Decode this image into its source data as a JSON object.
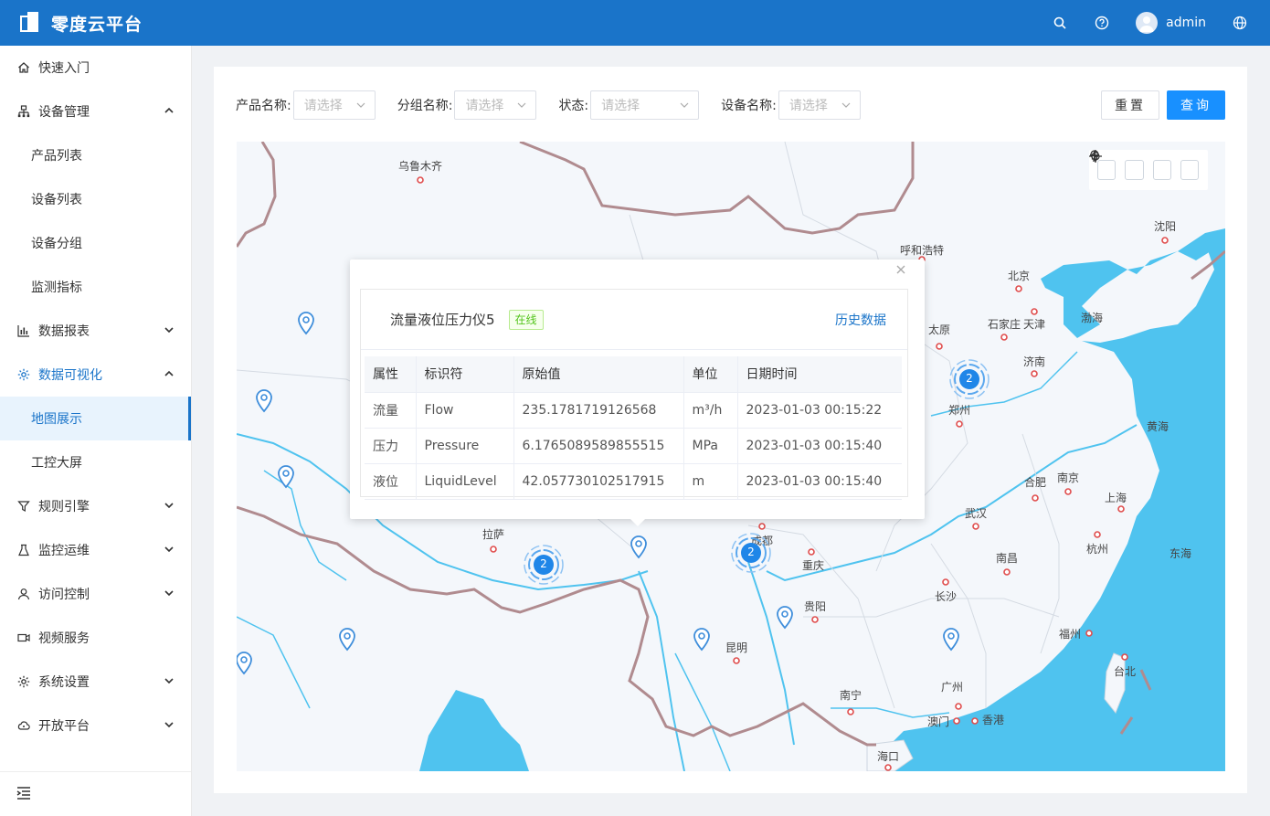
{
  "app": {
    "title": "零度云平台"
  },
  "header": {
    "username": "admin",
    "icons": [
      "search-icon",
      "help-icon",
      "avatar",
      "globe-icon"
    ]
  },
  "sidebar": {
    "items": [
      {
        "label": "快速入门",
        "icon": "home-icon"
      },
      {
        "label": "设备管理",
        "icon": "device-icon",
        "expanded": true,
        "children": [
          "产品列表",
          "设备列表",
          "设备分组",
          "监测指标"
        ]
      },
      {
        "label": "数据报表",
        "icon": "bar-chart-icon",
        "expanded": false
      },
      {
        "label": "数据可视化",
        "icon": "gear-icon",
        "expanded": true,
        "active": true,
        "children": [
          "地图展示",
          "工控大屏"
        ],
        "active_child": "地图展示"
      },
      {
        "label": "规则引擎",
        "icon": "filter-icon",
        "expanded": false
      },
      {
        "label": "监控运维",
        "icon": "flask-icon",
        "expanded": false
      },
      {
        "label": "访问控制",
        "icon": "user-icon",
        "expanded": false
      },
      {
        "label": "视频服务",
        "icon": "video-icon"
      },
      {
        "label": "系统设置",
        "icon": "settings-icon",
        "expanded": false
      },
      {
        "label": "开放平台",
        "icon": "cloud-icon",
        "expanded": false
      }
    ]
  },
  "filters": {
    "product_label": "产品名称:",
    "group_label": "分组名称:",
    "status_label": "状态:",
    "device_label": "设备名称:",
    "placeholder": "请选择",
    "reset": "重置",
    "query": "查询"
  },
  "map": {
    "cities": {
      "wulumuqi": "乌鲁木齐",
      "huhehaote": "呼和浩特",
      "shenyang": "沈阳",
      "beijing": "北京",
      "tianjin": "天津",
      "shijiazhuang": "石家庄",
      "taiyuan": "太原",
      "jinan": "济南",
      "zhengzhou": "郑州",
      "hefei": "合肥",
      "nanjing": "南京",
      "shanghai": "上海",
      "wuhan": "武汉",
      "hangzhou": "杭州",
      "lasa": "拉萨",
      "chengdu": "成都",
      "chongqing": "重庆",
      "nanchang": "南昌",
      "changsha": "长沙",
      "guiyang": "贵阳",
      "kunming": "昆明",
      "fuzhou": "福州",
      "taibei": "台北",
      "guangzhou": "广州",
      "nanning": "南宁",
      "aomen": "澳门",
      "xianggang": "香港",
      "haikou": "海口"
    },
    "seas": {
      "bohai": "渤海",
      "huanghai": "黄海",
      "donghai": "东海"
    },
    "clusters": [
      {
        "count": "2"
      },
      {
        "count": "2"
      },
      {
        "count": "2"
      }
    ],
    "tools": [
      "bulb-icon",
      "locate-icon",
      "zoom-in-icon",
      "zoom-out-icon"
    ]
  },
  "popup": {
    "device_name": "流量液位压力仪5",
    "status": "在线",
    "history_link": "历史数据",
    "columns": [
      "属性",
      "标识符",
      "原始值",
      "单位",
      "日期时间"
    ],
    "rows": [
      [
        "流量",
        "Flow",
        "235.1781719126568",
        "m³/h",
        "2023-01-03 00:15:22"
      ],
      [
        "压力",
        "Pressure",
        "6.1765089589855515",
        "MPa",
        "2023-01-03 00:15:40"
      ],
      [
        "液位",
        "LiquidLevel",
        "42.057730102517915",
        "m",
        "2023-01-03 00:15:40"
      ]
    ]
  },
  "colors": {
    "primary": "#1a74c9",
    "button": "#1890ff",
    "water": "#4fc3ef",
    "border": "#b08b8f",
    "online": "#52c41a"
  }
}
